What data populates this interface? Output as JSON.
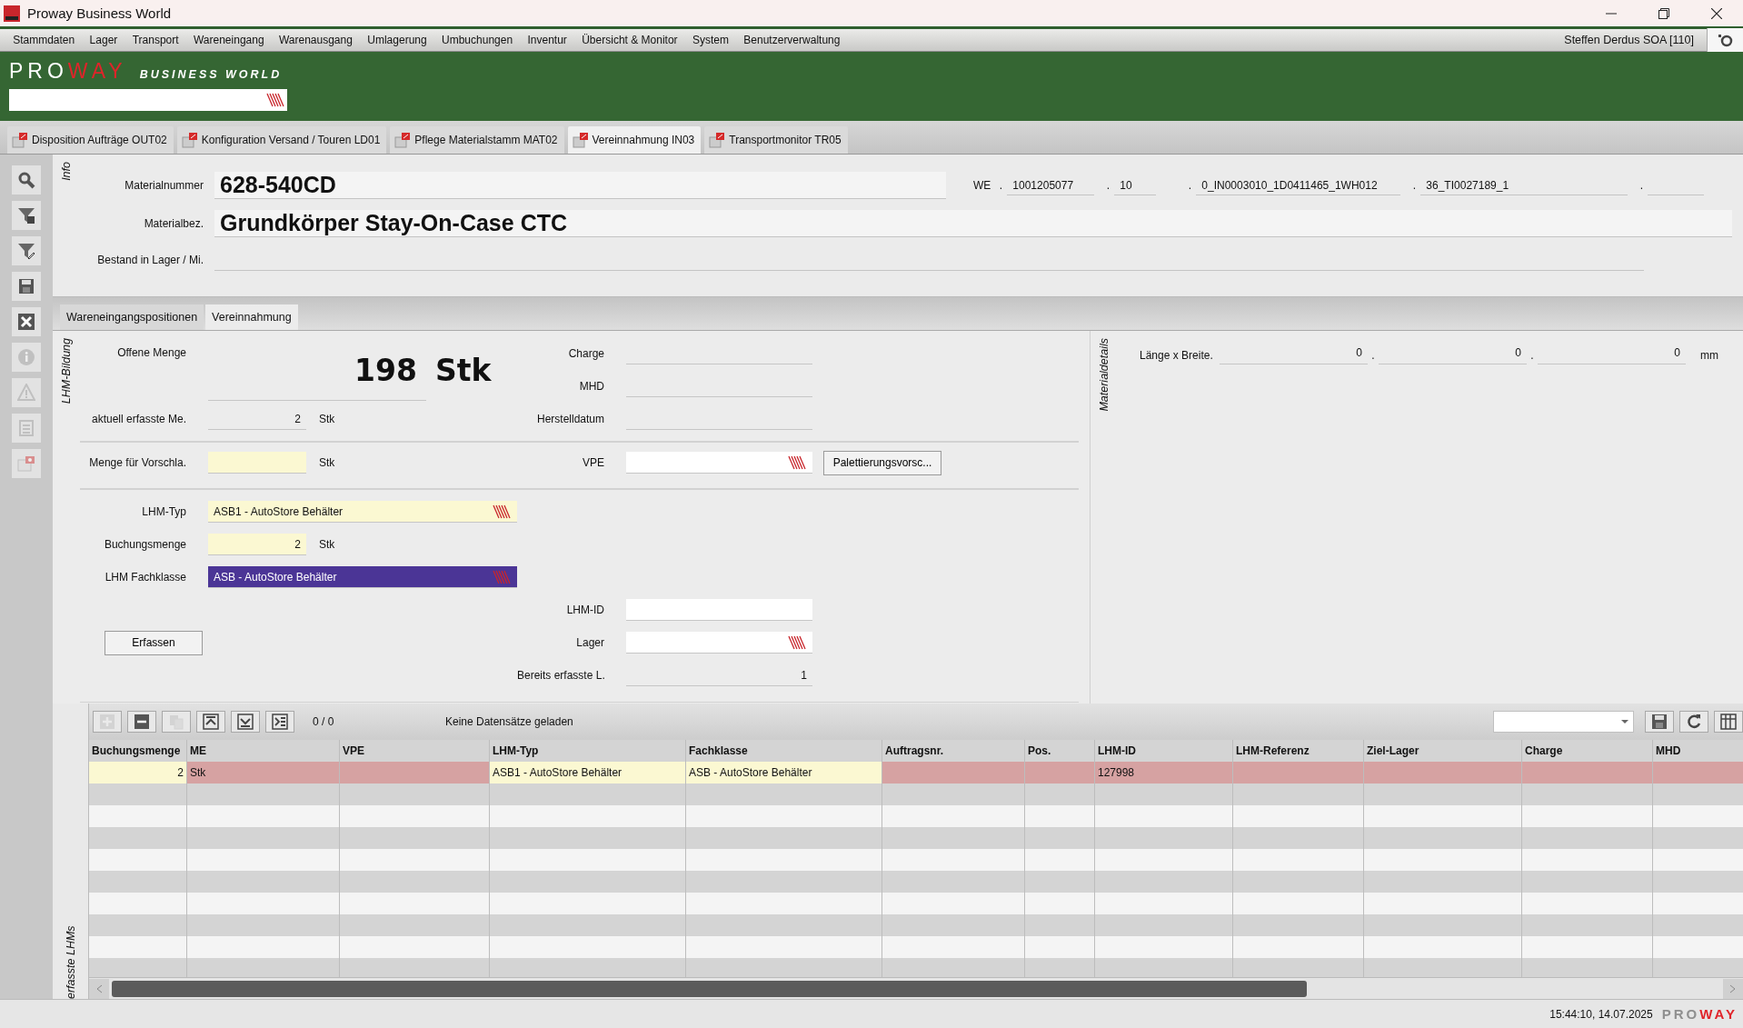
{
  "window": {
    "title": "Proway Business World"
  },
  "menu": [
    "Stammdaten",
    "Lager",
    "Transport",
    "Wareneingang",
    "Warenausgang",
    "Umlagerung",
    "Umbuchungen",
    "Inventur",
    "Übersicht & Monitor",
    "System",
    "Benutzerverwaltung"
  ],
  "user": "Steffen Derdus SOA [110]",
  "brand": {
    "pro": "PRO",
    "way": "WAY",
    "tagline": "BUSINESS WORLD"
  },
  "doc_tabs": [
    {
      "label": "Disposition Aufträge OUT02",
      "selected": false
    },
    {
      "label": "Konfiguration Versand / Touren LD01",
      "selected": false
    },
    {
      "label": "Pflege Materialstamm MAT02",
      "selected": false
    },
    {
      "label": "Vereinnahmung IN03",
      "selected": true
    },
    {
      "label": "Transportmonitor TR05",
      "selected": false
    }
  ],
  "side_toolbar": [
    {
      "kind": "search",
      "disabled": false
    },
    {
      "kind": "filter-clear",
      "disabled": false
    },
    {
      "kind": "filter-edit",
      "disabled": false
    },
    {
      "kind": "save",
      "disabled": false
    },
    {
      "kind": "close",
      "disabled": false
    },
    {
      "kind": "info",
      "disabled": true
    },
    {
      "kind": "warning",
      "disabled": true
    },
    {
      "kind": "list",
      "disabled": true
    },
    {
      "kind": "report",
      "disabled": true
    }
  ],
  "info": {
    "section": "Info",
    "material_number": {
      "label": "Materialnummer",
      "value": "628-540CD"
    },
    "material_name": {
      "label": "Materialbez.",
      "value": "Grundkörper Stay-On-Case CTC"
    },
    "stock": {
      "label": "Bestand in Lager / Mi."
    },
    "we": {
      "label": "WE",
      "separator": ".",
      "fields": [
        {
          "value": "1001205077"
        },
        {
          "value": "10"
        },
        {
          "value": "0_IN0003010_1D0411465_1WH012"
        },
        {
          "value": "36_TI0027189_1"
        }
      ]
    }
  },
  "sub_tabs": [
    {
      "label": "Wareneingangspositionen",
      "selected": false
    },
    {
      "label": "Vereinnahmung",
      "selected": true
    }
  ],
  "lhm": {
    "section": "LHM-Bildung",
    "open_qty": {
      "label": "Offene Menge",
      "value": "198",
      "unit": "Stk"
    },
    "captured_qty": {
      "label": "aktuell erfasste Me.",
      "value": "2",
      "unit": "Stk",
      "readonly": true
    },
    "charge": {
      "label": "Charge",
      "readonly": true
    },
    "mhd": {
      "label": "MHD",
      "readonly": true
    },
    "production_date": {
      "label": "Herstelldatum",
      "readonly": true
    },
    "suggestion_qty": {
      "label": "Menge für Vorschla.",
      "unit": "Stk",
      "required": true
    },
    "vpe": {
      "label": "VPE",
      "dropdown": true
    },
    "pallet_button": "Palettierungsvorsc...",
    "lhm_type": {
      "label": "LHM-Typ",
      "value": "ASB1 - AutoStore Behälter",
      "required": true,
      "dropdown": true
    },
    "booking_qty": {
      "label": "Buchungsmenge",
      "value": "2",
      "unit": "Stk",
      "required": true
    },
    "lhm_class": {
      "label": "LHM Fachklasse",
      "value": "ASB - AutoStore Behälter",
      "dropdown": true,
      "focused": true
    },
    "lhm_id": {
      "label": "LHM-ID"
    },
    "storage": {
      "label": "Lager",
      "dropdown": true
    },
    "capture_button": "Erfassen",
    "already": {
      "label": "Bereits erfasste L.",
      "value": "1",
      "readonly": true
    }
  },
  "details": {
    "section": "Materialdetails",
    "label": "Länge x Breite.",
    "separator": ".",
    "values": [
      "0",
      "0",
      "0"
    ],
    "unit": "mm"
  },
  "table": {
    "section": "erfasste LHMs",
    "tools": [
      {
        "kind": "add",
        "disabled": true
      },
      {
        "kind": "remove",
        "disabled": false
      },
      {
        "kind": "copy",
        "disabled": true
      },
      {
        "kind": "first",
        "disabled": false
      },
      {
        "kind": "last",
        "disabled": false
      },
      {
        "kind": "export",
        "disabled": false
      }
    ],
    "counter": "0 /  0",
    "message": "Keine Datensätze geladen",
    "right_tools": [
      {
        "kind": "save",
        "disabled": false
      },
      {
        "kind": "refresh",
        "disabled": false
      },
      {
        "kind": "columns",
        "disabled": false
      }
    ],
    "columns": [
      "Buchungsmenge",
      "ME",
      "VPE",
      "LHM-Typ",
      "Fachklasse",
      "Auftragsnr.",
      "Pos.",
      "LHM-ID",
      "LHM-Referenz",
      "Ziel-Lager",
      "Charge",
      "MHD"
    ],
    "rows": [
      {
        "selected": true,
        "cells": [
          {
            "text": "2",
            "editable": true
          },
          {
            "text": "Stk",
            "editable": false
          },
          {
            "editable": false
          },
          {
            "text": "ASB1 - AutoStore Behälter",
            "editable": true
          },
          {
            "text": "ASB - AutoStore Behälter",
            "editable": true
          },
          {
            "editable": false
          },
          {
            "editable": false
          },
          {
            "text": "127998",
            "editable": false
          },
          {
            "editable": false
          },
          {
            "editable": false
          },
          {
            "editable": false
          },
          {
            "editable": false
          }
        ]
      }
    ]
  },
  "status_bar": {
    "time": "15:44:10, 14.07.2025",
    "pro": "PRO",
    "way": "WAY"
  }
}
